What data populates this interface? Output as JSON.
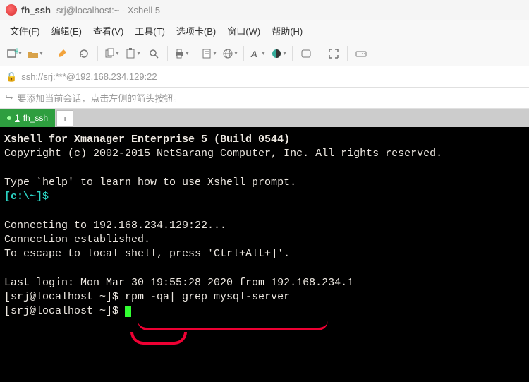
{
  "titlebar": {
    "session_name": "fh_ssh",
    "rest": "srj@localhost:~ - Xshell 5"
  },
  "menu": {
    "file": "文件(F)",
    "edit": "编辑(E)",
    "view": "查看(V)",
    "tools": "工具(T)",
    "tabs": "选项卡(B)",
    "window": "窗口(W)",
    "help": "帮助(H)"
  },
  "address": {
    "url": "ssh://srj:***@192.168.234.129:22"
  },
  "info": {
    "hint": "要添加当前会话，点击左侧的箭头按钮。"
  },
  "tab": {
    "index": "1",
    "name": "fh_ssh",
    "add": "+"
  },
  "terminal": {
    "l1": "Xshell for Xmanager Enterprise 5 (Build 0544)",
    "l2": "Copyright (c) 2002-2015 NetSarang Computer, Inc. All rights reserved.",
    "l3": "",
    "l4a": "Type `help' to learn how to use Xshell prompt.",
    "l5prompt": "[c:\\~]$",
    "l6": "",
    "l7": "Connecting to 192.168.234.129:22...",
    "l8": "Connection established.",
    "l9": "To escape to local shell, press 'Ctrl+Alt+]'.",
    "l10": "",
    "l11": "Last login: Mon Mar 30 19:55:28 2020 from 192.168.234.1",
    "l12prompt": "[srj@localhost ~]$ ",
    "l12cmd": "rpm -qa| grep mysql-server",
    "l13prompt": "[srj@localhost ~]$ "
  }
}
